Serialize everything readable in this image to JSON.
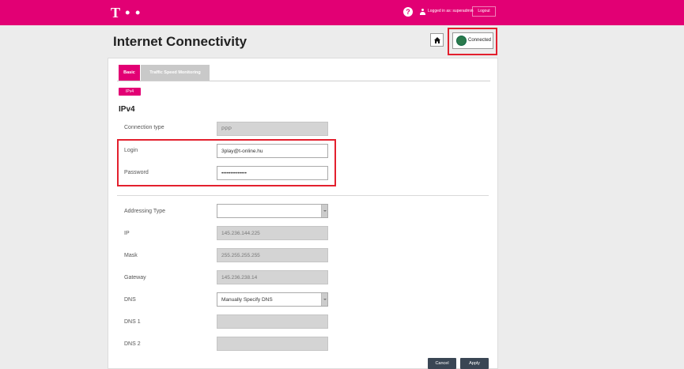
{
  "header": {
    "logo": "T • •",
    "help": "?",
    "logged_in": "Logged in as: superadmin",
    "logout": "Logout"
  },
  "page": {
    "title": "Internet Connectivity",
    "status": "Connected"
  },
  "tabs": [
    "Basic",
    "Traffic Speed Monitoring"
  ],
  "subtab": "IPv4",
  "section_title": "IPv4",
  "fields": {
    "connection_type": {
      "label": "Connection type",
      "value": "PPP"
    },
    "login": {
      "label": "Login",
      "value": "3play@t-online.hu"
    },
    "password": {
      "label": "Password",
      "value": "••••••••••••••"
    },
    "addressing_type": {
      "label": "Addressing Type",
      "value": ""
    },
    "ip": {
      "label": "IP",
      "value": "145.236.144.225"
    },
    "mask": {
      "label": "Mask",
      "value": "255.255.255.255"
    },
    "gateway": {
      "label": "Gateway",
      "value": "145.236.238.14"
    },
    "dns": {
      "label": "DNS",
      "value": "Manually Specify DNS"
    },
    "dns1": {
      "label": "DNS 1",
      "value": ""
    },
    "dns2": {
      "label": "DNS 2",
      "value": ""
    }
  },
  "buttons": {
    "cancel": "Cancel",
    "apply": "Apply"
  },
  "colors": {
    "brand": "#e20074",
    "highlight": "#e3202e",
    "button": "#3a4654"
  },
  "icons": [
    "help-icon",
    "user-icon",
    "home-icon",
    "globe-icon",
    "chevron-down-icon"
  ]
}
